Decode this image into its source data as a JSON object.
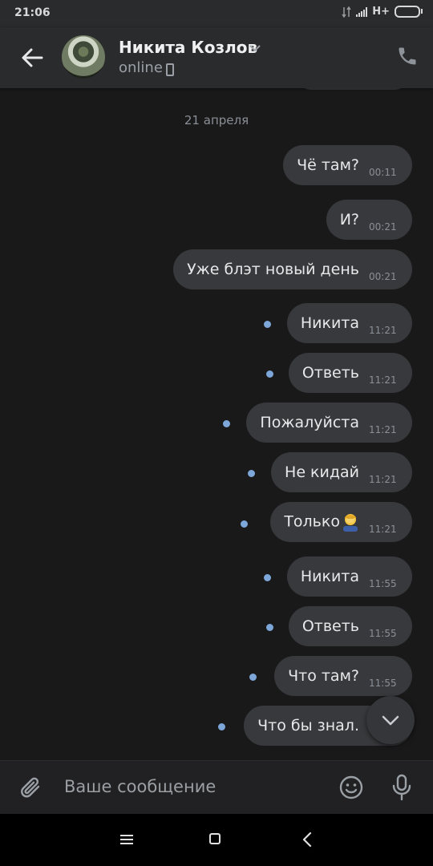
{
  "status_bar": {
    "time": "21:06",
    "network": "H+"
  },
  "header": {
    "name": "Никита Козлов",
    "status": "online"
  },
  "date_separator": "21 апреля",
  "messages": [
    {
      "text": "Чё там?",
      "time": "00:11"
    },
    {
      "text": "И?",
      "time": "00:21"
    },
    {
      "text": "Уже блэт новый день",
      "time": "00:21"
    },
    {
      "text": "Никита",
      "time": "11:21"
    },
    {
      "text": "Ответь",
      "time": "11:21"
    },
    {
      "text": "Пожалуйста",
      "time": "11:21"
    },
    {
      "text": "Не кидай",
      "time": "11:21"
    },
    {
      "text": "Только",
      "time": "11:21",
      "emoji": "person-facepalming"
    },
    {
      "text": "Никита",
      "time": "11:55"
    },
    {
      "text": "Ответь",
      "time": "11:55"
    },
    {
      "text": "Что там?",
      "time": "11:55"
    },
    {
      "text": "Что бы знал.",
      "time": ""
    }
  ],
  "composer": {
    "placeholder": "Ваше сообщение"
  },
  "colors": {
    "background": "#19191a",
    "bubble": "#38393c",
    "unread_dot": "#7ea7d9",
    "header": "#2a2b2d"
  },
  "icons": [
    "back-arrow-icon",
    "chevron-down-icon",
    "phone-icon",
    "attach-icon",
    "emoji-icon",
    "mic-icon",
    "scroll-down-icon"
  ]
}
